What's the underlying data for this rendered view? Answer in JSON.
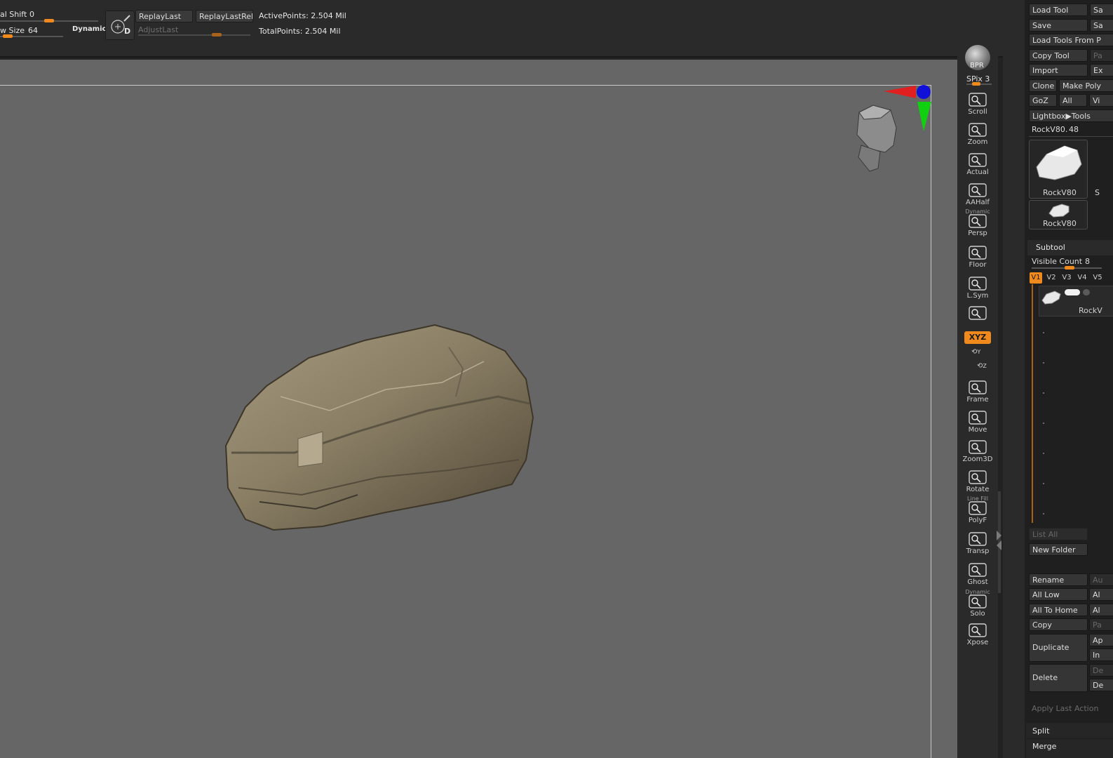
{
  "toolbar": {
    "focal_shift_label": "al Shift",
    "focal_shift_value": "0",
    "draw_size_label": "w Size",
    "draw_size_value": "64",
    "dynamic_label": "Dynamic",
    "replay_last": "ReplayLast",
    "replay_last_rel": "ReplayLastRel",
    "adjust_last": "AdjustLast",
    "active_points": "ActivePoints: 2.504 Mil",
    "total_points": "TotalPoints: 2.504 Mil",
    "draw_icon_letter": "D",
    "focal_shift_fraction": 0.5,
    "draw_size_fraction": 0.05,
    "adjust_last_fraction": 0.72
  },
  "shelf": {
    "bpr": "BPR",
    "spix": "SPix 3",
    "items": [
      {
        "label": "Scroll",
        "icon": "scroll-icon"
      },
      {
        "label": "Zoom",
        "icon": "zoom-icon"
      },
      {
        "label": "Actual",
        "icon": "actual-icon"
      },
      {
        "label": "AAHalf",
        "icon": "aahalf-icon"
      },
      {
        "label": "Persp",
        "icon": "persp-icon",
        "over": "Dynamic"
      },
      {
        "label": "Floor",
        "icon": "floor-icon"
      },
      {
        "label": "L.Sym",
        "icon": "lsym-icon"
      },
      {
        "label": "",
        "icon": "lock-icon"
      },
      {
        "label": "Frame",
        "icon": "frame-icon"
      },
      {
        "label": "Move",
        "icon": "move-icon"
      },
      {
        "label": "Zoom3D",
        "icon": "zoom3d-icon"
      },
      {
        "label": "Rotate",
        "icon": "rotate-icon"
      },
      {
        "label": "PolyF",
        "icon": "polyf-icon",
        "over": "Line Fill"
      },
      {
        "label": "Transp",
        "icon": "transp-icon"
      },
      {
        "label": "Ghost",
        "icon": "ghost-icon"
      },
      {
        "label": "Solo",
        "icon": "solo-icon",
        "over": "Dynamic"
      },
      {
        "label": "Xpose",
        "icon": "xpose-icon"
      }
    ],
    "xyz": "XYZ",
    "y_label": "Y",
    "z_label": "Z",
    "accent": "#f08a1c"
  },
  "tool_panel": {
    "load_tool": "Load Tool",
    "save_as": "Sa",
    "save": "Save",
    "save2": "Sa",
    "load_tools_from": "Load Tools From P",
    "copy_tool": "Copy Tool",
    "paste": "Pa",
    "import": "Import",
    "export": "Ex",
    "clone": "Clone",
    "make_poly": "Make Poly",
    "goz": "GoZ",
    "all": "All",
    "visible": "Vi",
    "lightbox_tools": "Lightbox▶Tools",
    "current_tool": "RockV80.",
    "current_tool_value": "48",
    "thumb1_label": "RockV80",
    "thumb1_side": "S",
    "thumb2_label": "RockV80"
  },
  "subtool": {
    "header": "Subtool",
    "visible_count_label": "Visible Count",
    "visible_count_value": "8",
    "visible_count_fraction": 0.55,
    "tabs": [
      "V1",
      "V2",
      "V3",
      "V4",
      "V5"
    ],
    "item_label": "RockV",
    "list_all": "List All",
    "new_folder": "New Folder",
    "rename": "Rename",
    "auto": "Au",
    "all_low": "All Low",
    "all_high": "Al",
    "all_to_home": "All To Home",
    "all_target": "Al",
    "copy": "Copy",
    "paste": "Pa",
    "duplicate": "Duplicate",
    "append": "Ap",
    "insert": "In",
    "delete": "Delete",
    "del_other": "De",
    "del_all": "De",
    "apply_last_action": "Apply Last Action",
    "split": "Split",
    "merge": "Merge"
  }
}
